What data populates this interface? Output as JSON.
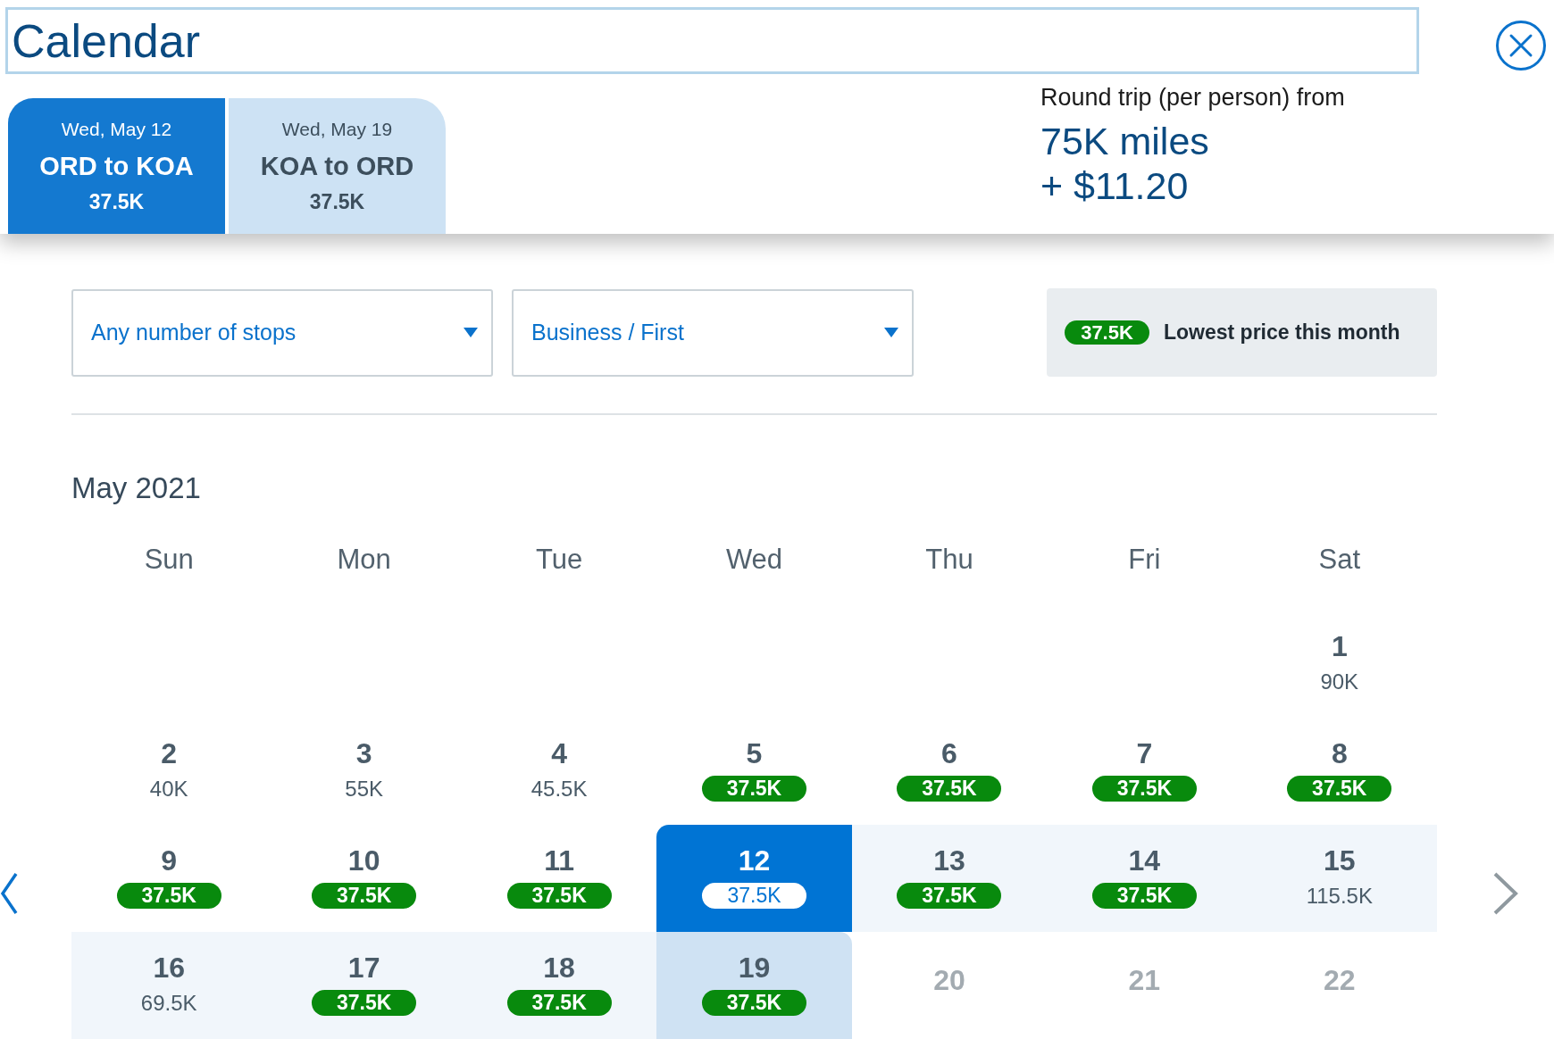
{
  "title": "Calendar",
  "tabs": [
    {
      "date": "Wed, May 12",
      "route": "ORD to KOA",
      "price": "37.5K",
      "selected": true
    },
    {
      "date": "Wed, May 19",
      "route": "KOA to ORD",
      "price": "37.5K",
      "selected": false
    }
  ],
  "fare_summary": {
    "label": "Round trip (per person) from",
    "miles": "75K miles",
    "fees": "+ $11.20"
  },
  "filters": [
    {
      "value": "Any number of stops"
    },
    {
      "value": "Business / First"
    }
  ],
  "legend": {
    "badge": "37.5K",
    "label": "Lowest price this month"
  },
  "calendar": {
    "month": "May 2021",
    "weekdays": [
      "Sun",
      "Mon",
      "Tue",
      "Wed",
      "Thu",
      "Fri",
      "Sat"
    ],
    "month_nav": {
      "previous": {
        "disabled": false
      },
      "next": {
        "disabled": true
      }
    },
    "weeks": [
      {
        "days": [
          {
            "kind": "blank"
          },
          {
            "kind": "blank"
          },
          {
            "kind": "blank"
          },
          {
            "kind": "blank"
          },
          {
            "kind": "blank"
          },
          {
            "kind": "blank"
          },
          {
            "kind": "day",
            "day": "1",
            "price": "90K",
            "lowest": false,
            "selected": false,
            "in_range": false,
            "return_day": false,
            "disabled": false
          }
        ]
      },
      {
        "days": [
          {
            "kind": "day",
            "day": "2",
            "price": "40K",
            "lowest": false,
            "selected": false,
            "in_range": false,
            "return_day": false,
            "disabled": false
          },
          {
            "kind": "day",
            "day": "3",
            "price": "55K",
            "lowest": false,
            "selected": false,
            "in_range": false,
            "return_day": false,
            "disabled": false
          },
          {
            "kind": "day",
            "day": "4",
            "price": "45.5K",
            "lowest": false,
            "selected": false,
            "in_range": false,
            "return_day": false,
            "disabled": false
          },
          {
            "kind": "day",
            "day": "5",
            "price": "37.5K",
            "lowest": true,
            "selected": false,
            "in_range": false,
            "return_day": false,
            "disabled": false
          },
          {
            "kind": "day",
            "day": "6",
            "price": "37.5K",
            "lowest": true,
            "selected": false,
            "in_range": false,
            "return_day": false,
            "disabled": false
          },
          {
            "kind": "day",
            "day": "7",
            "price": "37.5K",
            "lowest": true,
            "selected": false,
            "in_range": false,
            "return_day": false,
            "disabled": false
          },
          {
            "kind": "day",
            "day": "8",
            "price": "37.5K",
            "lowest": true,
            "selected": false,
            "in_range": false,
            "return_day": false,
            "disabled": false
          }
        ]
      },
      {
        "days": [
          {
            "kind": "day",
            "day": "9",
            "price": "37.5K",
            "lowest": true,
            "selected": false,
            "in_range": false,
            "return_day": false,
            "disabled": false
          },
          {
            "kind": "day",
            "day": "10",
            "price": "37.5K",
            "lowest": true,
            "selected": false,
            "in_range": false,
            "return_day": false,
            "disabled": false
          },
          {
            "kind": "day",
            "day": "11",
            "price": "37.5K",
            "lowest": true,
            "selected": false,
            "in_range": false,
            "return_day": false,
            "disabled": false
          },
          {
            "kind": "day",
            "day": "12",
            "price": "37.5K",
            "lowest": true,
            "selected": true,
            "in_range": false,
            "return_day": false,
            "disabled": false
          },
          {
            "kind": "day",
            "day": "13",
            "price": "37.5K",
            "lowest": true,
            "selected": false,
            "in_range": true,
            "return_day": false,
            "disabled": false
          },
          {
            "kind": "day",
            "day": "14",
            "price": "37.5K",
            "lowest": true,
            "selected": false,
            "in_range": true,
            "return_day": false,
            "disabled": false
          },
          {
            "kind": "day",
            "day": "15",
            "price": "115.5K",
            "lowest": false,
            "selected": false,
            "in_range": true,
            "return_day": false,
            "disabled": false
          }
        ]
      },
      {
        "days": [
          {
            "kind": "day",
            "day": "16",
            "price": "69.5K",
            "lowest": false,
            "selected": false,
            "in_range": true,
            "return_day": false,
            "disabled": false
          },
          {
            "kind": "day",
            "day": "17",
            "price": "37.5K",
            "lowest": true,
            "selected": false,
            "in_range": true,
            "return_day": false,
            "disabled": false
          },
          {
            "kind": "day",
            "day": "18",
            "price": "37.5K",
            "lowest": true,
            "selected": false,
            "in_range": true,
            "return_day": false,
            "disabled": false
          },
          {
            "kind": "day",
            "day": "19",
            "price": "37.5K",
            "lowest": true,
            "selected": false,
            "in_range": false,
            "return_day": true,
            "disabled": false
          },
          {
            "kind": "day",
            "day": "20",
            "selected": false,
            "in_range": false,
            "return_day": false,
            "disabled": true
          },
          {
            "kind": "day",
            "day": "21",
            "selected": false,
            "in_range": false,
            "return_day": false,
            "disabled": true
          },
          {
            "kind": "day",
            "day": "22",
            "selected": false,
            "in_range": false,
            "return_day": false,
            "disabled": true
          }
        ]
      }
    ]
  }
}
